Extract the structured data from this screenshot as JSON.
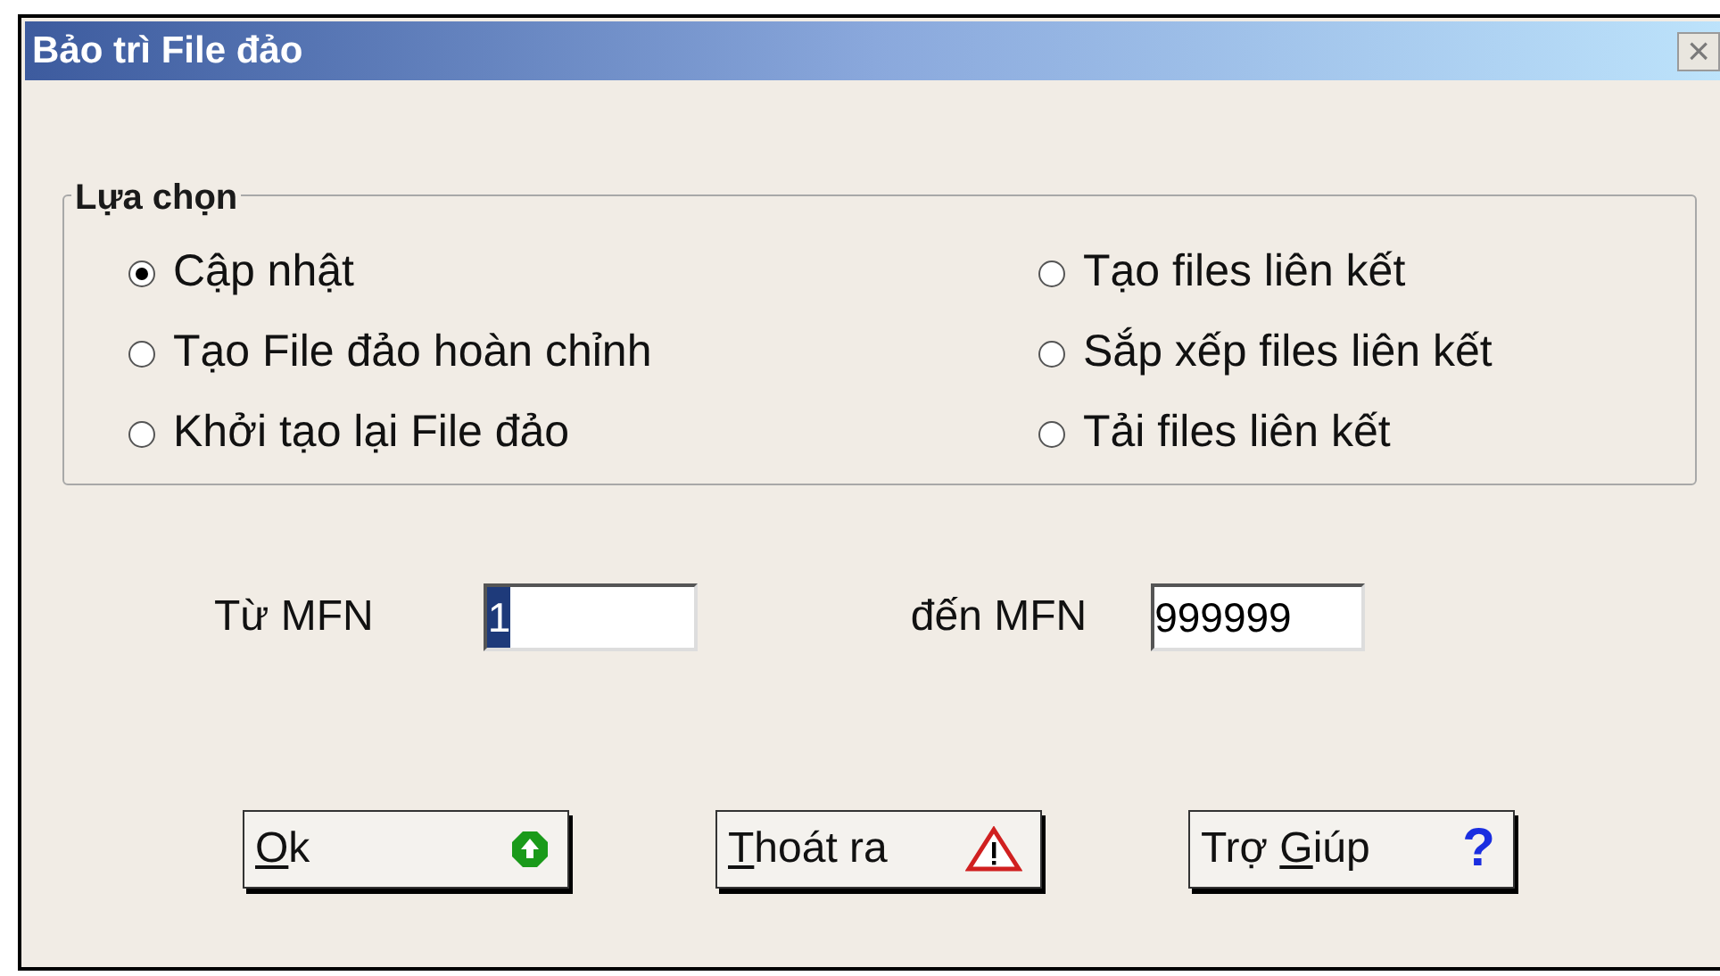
{
  "window": {
    "title": "Bảo trì File đảo",
    "close": "×"
  },
  "options": {
    "legend": "Lựa chọn",
    "items": [
      {
        "label": "Cập nhật",
        "selected": true
      },
      {
        "label": "Tạo files liên kết",
        "selected": false
      },
      {
        "label": "Tạo File đảo hoàn chỉnh",
        "selected": false
      },
      {
        "label": "Sắp xếp files liên kết",
        "selected": false
      },
      {
        "label": "Khởi tạo lại File đảo",
        "selected": false
      },
      {
        "label": "Tải files liên kết",
        "selected": false
      }
    ]
  },
  "range": [
    {
      "label": "Từ MFN",
      "value": "1",
      "text_selected": true
    },
    {
      "label": "đến MFN",
      "value": "999999",
      "text_selected": false
    }
  ],
  "buttons": [
    {
      "kind": "ok",
      "mnemonic": "O",
      "after": "k"
    },
    {
      "kind": "warning",
      "mnemonic": "T",
      "after": "hoát ra"
    },
    {
      "kind": "help",
      "before": "Trợ ",
      "mnemonic": "G",
      "after": "iúp",
      "icon_text": "?"
    }
  ]
}
